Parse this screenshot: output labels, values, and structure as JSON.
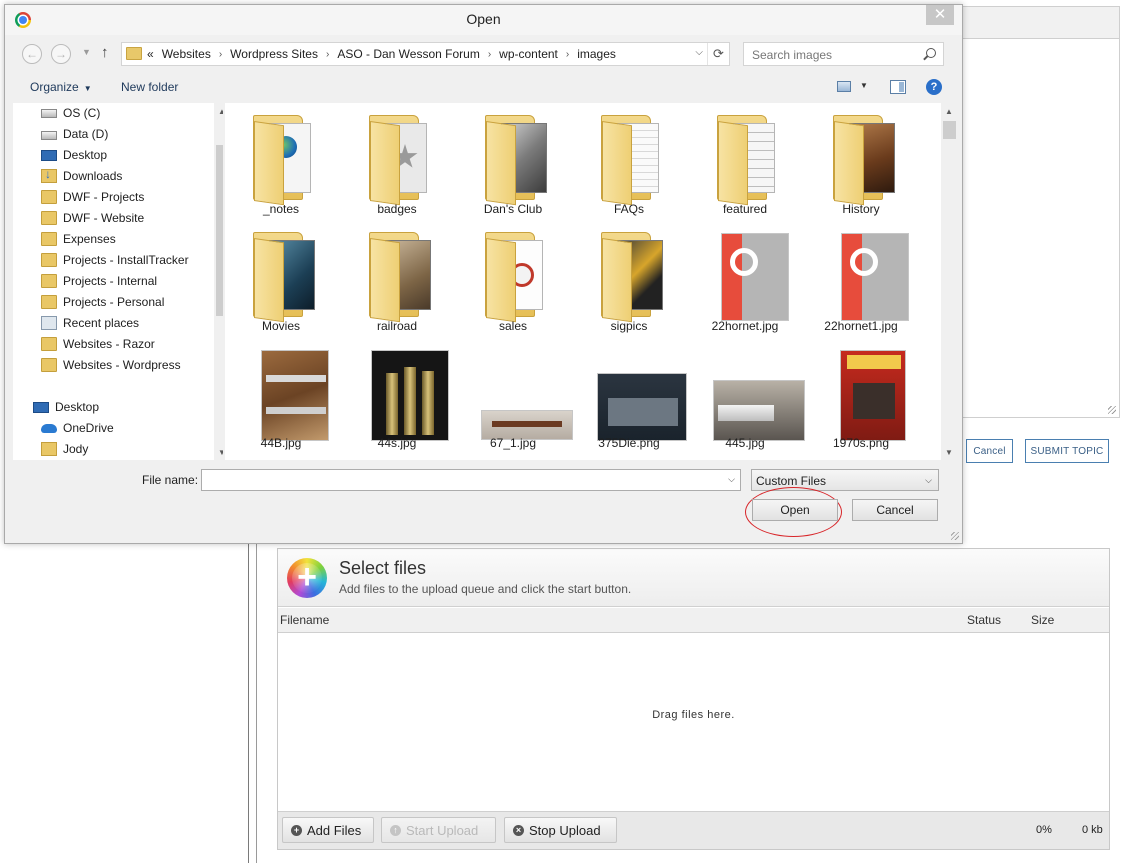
{
  "dialog": {
    "title": "Open",
    "close_glyph": "✕",
    "nav": {
      "back_glyph": "←",
      "forward_glyph": "→",
      "recent_glyph": "▼",
      "up_glyph": "↑"
    },
    "address": {
      "overflow": "«",
      "segments": [
        "Websites",
        "Wordpress Sites",
        "ASO - Dan Wesson Forum",
        "wp-content",
        "images"
      ],
      "separator": "›",
      "dropdown_glyph": "⌵",
      "refresh_glyph": "⟳"
    },
    "search_placeholder": "Search images",
    "toolbar": {
      "organize": "Organize",
      "new_folder": "New folder",
      "caret": "▼",
      "help": "?"
    },
    "nav_items": [
      {
        "label": "OS (C)",
        "icon": "os-drive-icon"
      },
      {
        "label": "Data (D)",
        "icon": "drive-icon"
      },
      {
        "label": "Desktop",
        "icon": "desktop-icon"
      },
      {
        "label": "Downloads",
        "icon": "downloads-icon"
      },
      {
        "label": "DWF - Projects",
        "icon": "folder-icon"
      },
      {
        "label": "DWF - Website",
        "icon": "folder-icon"
      },
      {
        "label": "Expenses",
        "icon": "folder-icon"
      },
      {
        "label": "Projects - InstallTracker",
        "icon": "folder-icon"
      },
      {
        "label": "Projects - Internal",
        "icon": "folder-icon"
      },
      {
        "label": "Projects - Personal",
        "icon": "folder-icon"
      },
      {
        "label": "Recent places",
        "icon": "recent-places-icon"
      },
      {
        "label": "Websites - Razor",
        "icon": "folder-icon"
      },
      {
        "label": "Websites - Wordpress",
        "icon": "folder-icon"
      },
      {
        "label": "Desktop",
        "icon": "desktop-icon"
      },
      {
        "label": "OneDrive",
        "icon": "onedrive-icon"
      },
      {
        "label": "Jody",
        "icon": "user-folder-icon"
      }
    ],
    "files": [
      {
        "name": "_notes",
        "kind": "folder"
      },
      {
        "name": "badges",
        "kind": "folder"
      },
      {
        "name": "Dan's Club",
        "kind": "folder"
      },
      {
        "name": "FAQs",
        "kind": "folder"
      },
      {
        "name": "featured",
        "kind": "folder"
      },
      {
        "name": "History",
        "kind": "folder"
      },
      {
        "name": "Movies",
        "kind": "folder"
      },
      {
        "name": "railroad",
        "kind": "folder"
      },
      {
        "name": "sales",
        "kind": "folder"
      },
      {
        "name": "sigpics",
        "kind": "folder"
      },
      {
        "name": "22hornet.jpg",
        "kind": "image"
      },
      {
        "name": "22hornet1.jpg",
        "kind": "image"
      },
      {
        "name": "44B.jpg",
        "kind": "image"
      },
      {
        "name": "44s.jpg",
        "kind": "image"
      },
      {
        "name": "67_1.jpg",
        "kind": "image"
      },
      {
        "name": "375Die.png",
        "kind": "image"
      },
      {
        "name": "445.jpg",
        "kind": "image"
      },
      {
        "name": "1970s.png",
        "kind": "image"
      }
    ],
    "file_name_label": "File name:",
    "file_name_value": "",
    "file_type": "Custom Files",
    "open_button": "Open",
    "cancel_button": "Cancel",
    "scroll_up": "▲",
    "scroll_down": "▼"
  },
  "page": {
    "cancel_button": "Cancel",
    "submit_button": "SUBMIT TOPIC"
  },
  "uploader": {
    "plus_glyph": "+",
    "title": "Select files",
    "subtitle": "Add files to the upload queue and click the start button.",
    "columns": {
      "filename": "Filename",
      "status": "Status",
      "size": "Size"
    },
    "drop_text": "Drag files here.",
    "add_files": "Add Files",
    "start_upload": "Start Upload",
    "stop_upload": "Stop Upload",
    "add_glyph": "+",
    "start_glyph": "↑",
    "stop_glyph": "×",
    "percent": "0%",
    "total_size": "0 kb"
  }
}
